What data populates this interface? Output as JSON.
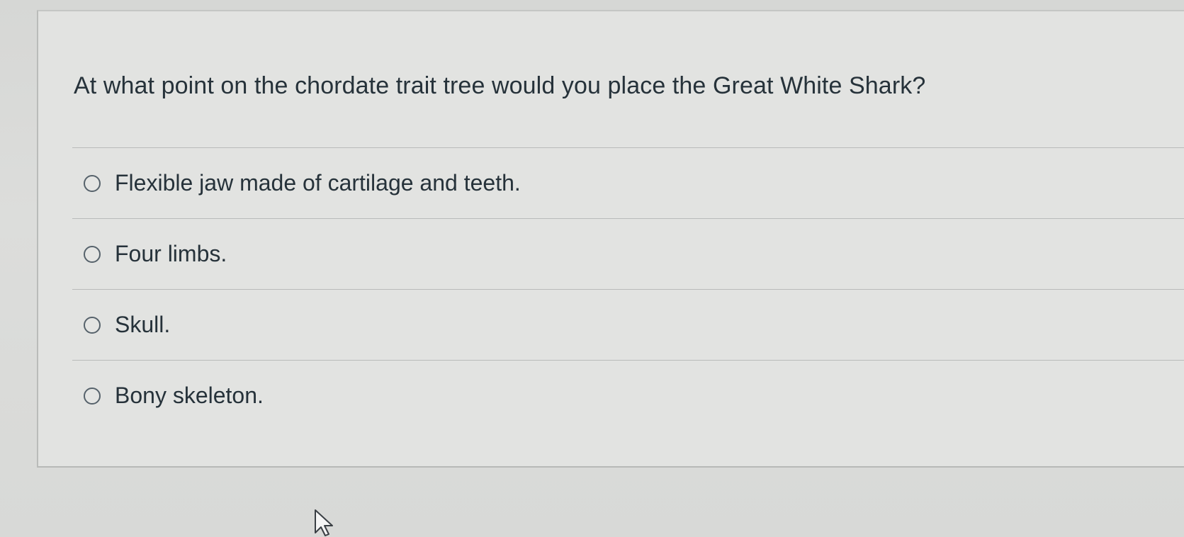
{
  "question": {
    "text": "At what point on the chordate trait tree would you place the Great White Shark?"
  },
  "answers": [
    {
      "label": "Flexible jaw made of cartilage and teeth.",
      "selected": false
    },
    {
      "label": "Four limbs.",
      "selected": false
    },
    {
      "label": "Skull.",
      "selected": false
    },
    {
      "label": "Bony skeleton.",
      "selected": false
    }
  ],
  "cursor": {
    "icon": "arrow-cursor-icon"
  }
}
